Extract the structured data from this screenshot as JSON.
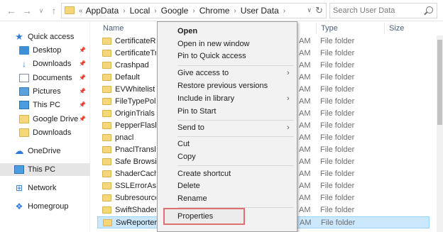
{
  "address_bar": {
    "overflow": "«",
    "crumbs": [
      "AppData",
      "Local",
      "Google",
      "Chrome",
      "User Data"
    ],
    "search_placeholder": "Search User Data"
  },
  "sidebar": {
    "items": [
      {
        "label": "Quick access",
        "icon": "star-icon",
        "pinned": false
      },
      {
        "label": "Desktop",
        "icon": "desktop-icon",
        "pinned": true
      },
      {
        "label": "Downloads",
        "icon": "download-icon",
        "pinned": true
      },
      {
        "label": "Documents",
        "icon": "documents-icon",
        "pinned": true
      },
      {
        "label": "Pictures",
        "icon": "pictures-icon",
        "pinned": true
      },
      {
        "label": "This PC",
        "icon": "computer-icon",
        "pinned": true
      },
      {
        "label": "Google Drive",
        "icon": "folder-icon",
        "pinned": true
      },
      {
        "label": "Downloads",
        "icon": "folder-icon",
        "pinned": false
      },
      {
        "label": "OneDrive",
        "icon": "cloud-icon",
        "pinned": false
      },
      {
        "label": "This PC",
        "icon": "computer-icon",
        "pinned": false,
        "selected": true
      },
      {
        "label": "Network",
        "icon": "network-icon",
        "pinned": false
      },
      {
        "label": "Homegroup",
        "icon": "homegroup-icon",
        "pinned": false
      }
    ]
  },
  "columns": {
    "name": "Name",
    "type": "Type",
    "size": "Size"
  },
  "files": [
    {
      "name": "CertificateRevocation",
      "time": "AM",
      "type": "File folder"
    },
    {
      "name": "CertificateTransparency",
      "time": "AM",
      "type": "File folder"
    },
    {
      "name": "Crashpad",
      "time": "AM",
      "type": "File folder"
    },
    {
      "name": "Default",
      "time": "AM",
      "type": "File folder"
    },
    {
      "name": "EVWhitelist",
      "time": "AM",
      "type": "File folder"
    },
    {
      "name": "FileTypePolicies",
      "time": "AM",
      "type": "File folder"
    },
    {
      "name": "OriginTrials",
      "time": "AM",
      "type": "File folder"
    },
    {
      "name": "PepperFlash",
      "time": "AM",
      "type": "File folder"
    },
    {
      "name": "pnacl",
      "time": "AM",
      "type": "File folder"
    },
    {
      "name": "PnaclTranslationCache",
      "time": "AM",
      "type": "File folder"
    },
    {
      "name": "Safe Browsing",
      "time": "AM",
      "type": "File folder"
    },
    {
      "name": "ShaderCache",
      "time": "AM",
      "type": "File folder"
    },
    {
      "name": "SSLErrorAssistant",
      "time": "AM",
      "type": "File folder"
    },
    {
      "name": "Subresource Filter",
      "time": "AM",
      "type": "File folder"
    },
    {
      "name": "SwiftShader",
      "time": "AM",
      "type": "File folder"
    },
    {
      "name": "SwReporter",
      "time": "AM",
      "type": "File folder",
      "selected": true
    }
  ],
  "context_menu": {
    "items": [
      "Open",
      "Open in new window",
      "Pin to Quick access",
      "Give access to",
      "Restore previous versions",
      "Include in library",
      "Pin to Start",
      "Send to",
      "Cut",
      "Copy",
      "Create shortcut",
      "Delete",
      "Rename",
      "Properties"
    ],
    "highlight_color": "#e07070"
  }
}
